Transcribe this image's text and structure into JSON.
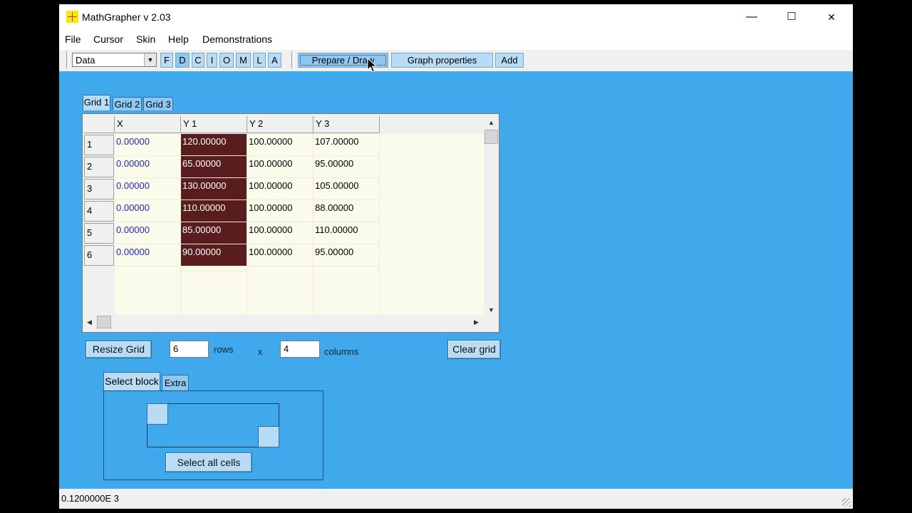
{
  "window": {
    "title": "MathGrapher v 2.03",
    "minimize": "—",
    "maximize": "☐",
    "close": "✕"
  },
  "menu": {
    "items": [
      "File",
      "Cursor",
      "Skin",
      "Help",
      "Demonstrations"
    ]
  },
  "toolbar": {
    "mode_select": "Data",
    "letters": [
      "F",
      "D",
      "C",
      "I",
      "O",
      "M",
      "L",
      "A"
    ],
    "selected_letter": "D",
    "prepare_draw": "Prepare / Draw",
    "graph_properties": "Graph properties",
    "add": "Add"
  },
  "grid_tabs": [
    "Grid 1",
    "Grid 2",
    "Grid 3"
  ],
  "grid": {
    "headers": [
      "X",
      "Y 1",
      "Y 2",
      "Y 3"
    ],
    "rows": [
      {
        "num": "1",
        "cells": [
          "0.00000",
          "120.00000",
          "100.00000",
          "107.00000"
        ]
      },
      {
        "num": "2",
        "cells": [
          "0.00000",
          "65.00000",
          "100.00000",
          "95.00000"
        ]
      },
      {
        "num": "3",
        "cells": [
          "0.00000",
          "130.00000",
          "100.00000",
          "105.00000"
        ]
      },
      {
        "num": "4",
        "cells": [
          "0.00000",
          "110.00000",
          "100.00000",
          "88.00000"
        ]
      },
      {
        "num": "5",
        "cells": [
          "0.00000",
          "85.00000",
          "100.00000",
          "110.00000"
        ]
      },
      {
        "num": "6",
        "cells": [
          "0.00000",
          "90.00000",
          "100.00000",
          "95.00000"
        ]
      }
    ],
    "highlight_color": "#5a1d1d",
    "background_color": "#fbfbec"
  },
  "resize": {
    "button": "Resize Grid",
    "rows_value": "6",
    "rows_label": "rows",
    "x_label": "x",
    "cols_value": "4",
    "cols_label": "columns",
    "clear_button": "Clear grid"
  },
  "select_tabs": [
    "Select block",
    "Extra"
  ],
  "select_block": {
    "select_all": "Select all cells"
  },
  "status": {
    "text": "0.1200000E  3"
  },
  "colors": {
    "client_bg": "#40a9ec",
    "button_bg": "#b8dcf5"
  }
}
